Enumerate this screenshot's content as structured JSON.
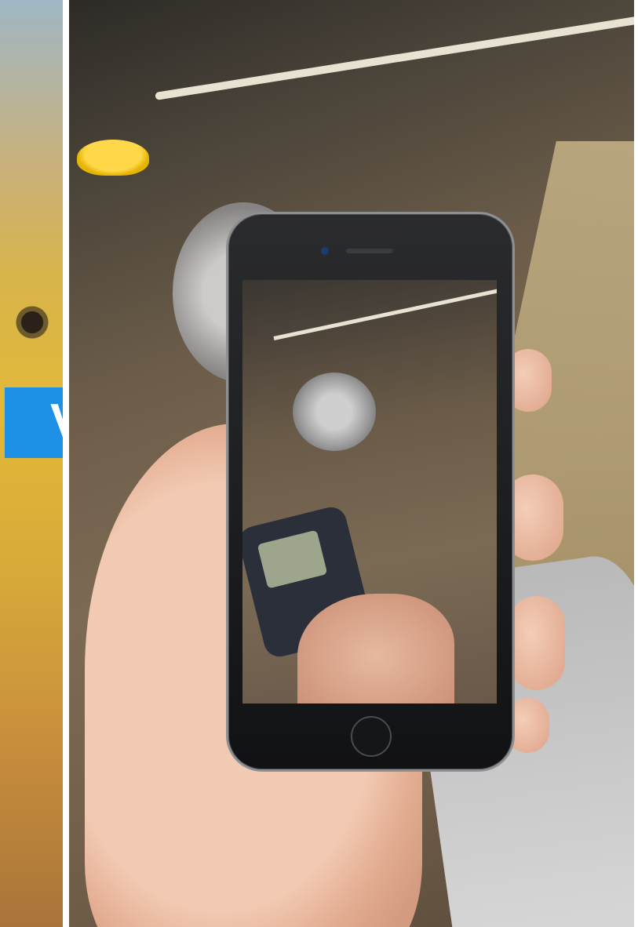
{
  "banner": {
    "text": "V"
  },
  "colors": {
    "banner": "#1e90e6",
    "divider": "#ffffff",
    "phone_body": "#1a1b1d",
    "phone_rim": "#8e8f92"
  },
  "scene": {
    "left_panel": "chick-photo",
    "right_panel": "hand-holding-phone-photo",
    "phone_screen": "anemometer-reading-photo"
  }
}
